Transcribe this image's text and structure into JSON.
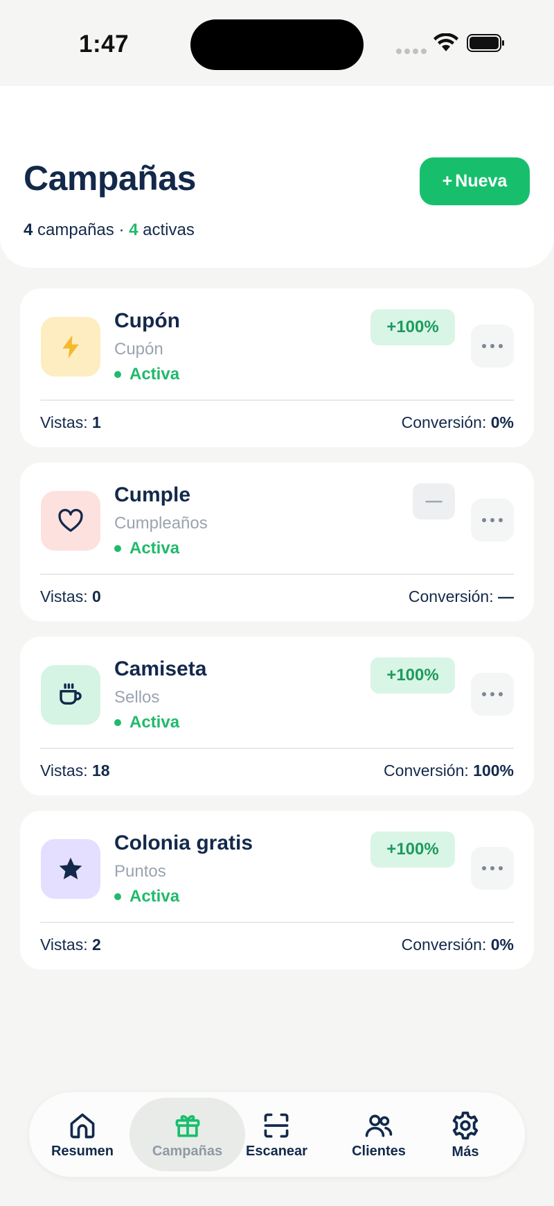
{
  "status_bar": {
    "time": "1:47"
  },
  "header": {
    "title": "Campañas",
    "count_campaigns": "4",
    "count_campaigns_label": "campañas",
    "separator": "·",
    "count_active": "4",
    "count_active_label": "activas",
    "new_button_label": "Nueva",
    "new_button_prefix": "+"
  },
  "colors": {
    "accent": "#17bf6d",
    "active_green": "#1fba6b",
    "text_dark": "#13294b"
  },
  "campaigns": [
    {
      "title": "Cupón",
      "type": "Cupón",
      "status": "Activa",
      "badge": "+100%",
      "views_label": "Vistas:",
      "views": "1",
      "conversion_label": "Conversión:",
      "conversion": "0%",
      "icon": "lightning-icon",
      "tile_color": "#fdedc0"
    },
    {
      "title": "Cumple",
      "type": "Cumpleaños",
      "status": "Activa",
      "badge": "—",
      "views_label": "Vistas:",
      "views": "0",
      "conversion_label": "Conversión:",
      "conversion": "—",
      "icon": "heart-icon",
      "tile_color": "#fde1de"
    },
    {
      "title": "Camiseta",
      "type": "Sellos",
      "status": "Activa",
      "badge": "+100%",
      "views_label": "Vistas:",
      "views": "18",
      "conversion_label": "Conversión:",
      "conversion": "100%",
      "icon": "cup-icon",
      "tile_color": "#d5f4e4"
    },
    {
      "title": "Colonia gratis",
      "type": "Puntos",
      "status": "Activa",
      "badge": "+100%",
      "views_label": "Vistas:",
      "views": "2",
      "conversion_label": "Conversión:",
      "conversion": "0%",
      "icon": "star-icon",
      "tile_color": "#e4deff"
    }
  ],
  "nav": {
    "items": [
      {
        "label": "Resumen",
        "icon": "home-icon",
        "active": false
      },
      {
        "label": "Campañas",
        "icon": "gift-icon",
        "active": true
      },
      {
        "label": "Escanear",
        "icon": "scan-icon",
        "active": false
      },
      {
        "label": "Clientes",
        "icon": "users-icon",
        "active": false
      },
      {
        "label": "Más",
        "icon": "gear-icon",
        "active": false
      }
    ]
  }
}
